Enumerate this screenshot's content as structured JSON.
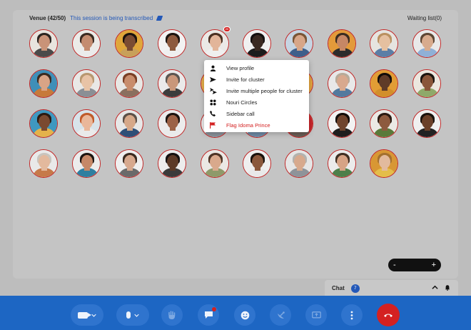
{
  "venue": {
    "title": "Venue (42/50)",
    "transcription_notice": "This session is being transcribed",
    "waiting_list": "Waiting list(0)"
  },
  "attendees": [
    {
      "skin": "#c99378",
      "hair": "#2b2420",
      "shirt": "#4a4a4a",
      "bg": "#e8e4de"
    },
    {
      "skin": "#c48c70",
      "hair": "#3b2a22",
      "shirt": "#ebebeb",
      "bg": "#ecebe8"
    },
    {
      "skin": "#7a4b32",
      "hair": "#1a120e",
      "shirt": "#c8a05a",
      "bg": "#e0a63a"
    },
    {
      "skin": "#8d5a3e",
      "hair": "#1b130f",
      "shirt": "#efefef",
      "bg": "#f2f2f2"
    },
    {
      "skin": "#e2b59a",
      "hair": "#4a3022",
      "shirt": "#efefef",
      "bg": "#ebe9e6"
    },
    {
      "skin": "#3a2a22",
      "hair": "#141010",
      "shirt": "#1c1c1c",
      "bg": "#f0f0f0"
    },
    {
      "skin": "#d7a688",
      "hair": "#7a5536",
      "shirt": "#3f5f8a",
      "bg": "#c6d4e2"
    },
    {
      "skin": "#c68765",
      "hair": "#3a2b20",
      "shirt": "#2c2c2c",
      "bg": "#e39a3a"
    },
    {
      "skin": "#e5c0a0",
      "hair": "#b99060",
      "shirt": "#5b7ea6",
      "bg": "#e6e4e0"
    },
    {
      "skin": "#d8ab8d",
      "hair": "#5d4634",
      "shirt": "#8fb0d6",
      "bg": "#e9e9e9"
    },
    {
      "skin": "#d9a486",
      "hair": "#3a2a20",
      "shirt": "#c77a3a",
      "bg": "#3f8fb8"
    },
    {
      "skin": "#e8c3a6",
      "hair": "#b89770",
      "shirt": "#8a8f95",
      "bg": "#e9e8e6"
    },
    {
      "skin": "#c88d6c",
      "hair": "#7a3f25",
      "shirt": "#8a6f5e",
      "bg": "#e8e7e4"
    },
    {
      "skin": "#c9977a",
      "hair": "#5a5550",
      "shirt": "#3c3c3c",
      "bg": "#eaeaea"
    },
    {
      "skin": "#d6a184",
      "hair": "#3a2a20",
      "shirt": "#d9a34c",
      "bg": "#e6b04a"
    },
    {
      "skin": "#e2b79a",
      "hair": "#c4a076",
      "shirt": "#263a5c",
      "bg": "#e8e8e8"
    },
    {
      "skin": "#7b4c33",
      "hair": "#1c140f",
      "shirt": "#2a6c58",
      "bg": "#e3a43e"
    },
    {
      "skin": "#d8a98e",
      "hair": "#b7aa99",
      "shirt": "#53799e",
      "bg": "#e8e8e8"
    },
    {
      "skin": "#5f3b28",
      "hair": "#120c09",
      "shirt": "#d28f2c",
      "bg": "#e29d35"
    },
    {
      "skin": "#8a563a",
      "hair": "#1c140f",
      "shirt": "#8fa96a",
      "bg": "#ece7df"
    },
    {
      "skin": "#7a4a30",
      "hair": "#2a1a12",
      "shirt": "#e4b24a",
      "bg": "#3f98c0"
    },
    {
      "skin": "#eab79a",
      "hair": "#c05a2a",
      "shirt": "#eaeaea",
      "bg": "#d8e3ea"
    },
    {
      "skin": "#d6a889",
      "hair": "#5d5048",
      "shirt": "#2f4f77",
      "bg": "#e7e7e7"
    },
    {
      "skin": "#9c6246",
      "hair": "#1b130f",
      "shirt": "#eaeaea",
      "bg": "#ececec"
    },
    {
      "skin": "#d8a98e",
      "hair": "#4a3324",
      "shirt": "#8a939b",
      "bg": "#ebebeb"
    },
    {
      "skin": "#dfb497",
      "hair": "#b08a62",
      "shirt": "#6f8aa5",
      "bg": "#ececec"
    },
    {
      "skin": "#d7a688",
      "hair": "#c4c2bf",
      "shirt": "#6b5e55",
      "bg": "#c9252a"
    },
    {
      "skin": "#6f442d",
      "hair": "#120c09",
      "shirt": "#1e1e1e",
      "bg": "#f2f2f2"
    },
    {
      "skin": "#8d5a3e",
      "hair": "#2a1a12",
      "shirt": "#5a7a3a",
      "bg": "#ebe9e5"
    },
    {
      "skin": "#6a4029",
      "hair": "#1a120d",
      "shirt": "#222222",
      "bg": "#f0f0f0"
    },
    {
      "skin": "#e3b99d",
      "hair": "#c9c4bd",
      "shirt": "#c67a4a",
      "bg": "#e9e9e9"
    },
    {
      "skin": "#c68867",
      "hair": "#1d1511",
      "shirt": "#2f7fa0",
      "bg": "#ececec"
    },
    {
      "skin": "#d7a98e",
      "hair": "#3b2a20",
      "shirt": "#6a6a6a",
      "bg": "#efefef"
    },
    {
      "skin": "#5c3a27",
      "hair": "#141010",
      "shirt": "#3b3b3b",
      "bg": "#ececec"
    },
    {
      "skin": "#d9a98c",
      "hair": "#4d3426",
      "shirt": "#8f9a6a",
      "bg": "#ebe8e4"
    },
    {
      "skin": "#8a583c",
      "hair": "#1a120d",
      "shirt": "#e9e9e9",
      "bg": "#efefef"
    },
    {
      "skin": "#d7a98d",
      "hair": "#b4b2ae",
      "shirt": "#8e9399",
      "bg": "#e5e5e5"
    },
    {
      "skin": "#d6a385",
      "hair": "#3f2e22",
      "shirt": "#4d7f4a",
      "bg": "#ebebeb"
    },
    {
      "skin": "#e2ba9d",
      "hair": "#a3702f",
      "shirt": "#e4bd4a",
      "bg": "#d89734"
    }
  ],
  "notification_badge": "20",
  "context_menu": [
    {
      "icon": "user-icon",
      "label": "View profile"
    },
    {
      "icon": "send-icon",
      "label": "Invite for cluster"
    },
    {
      "icon": "group-send-icon",
      "label": "Invite multiple people for cluster"
    },
    {
      "icon": "circles-icon",
      "label": "Nouri Circles"
    },
    {
      "icon": "phone-icon",
      "label": "Sidebar call"
    },
    {
      "icon": "flag-icon",
      "label": "Flag Idoma Prince"
    }
  ],
  "zoom": {
    "minus": "-",
    "plus": "+"
  },
  "chat": {
    "title": "Chat",
    "count": "7"
  },
  "colors": {
    "toolbar": "#1d66c3",
    "accent": "#2358b8",
    "danger": "#d42121",
    "ring": "#c42323"
  }
}
